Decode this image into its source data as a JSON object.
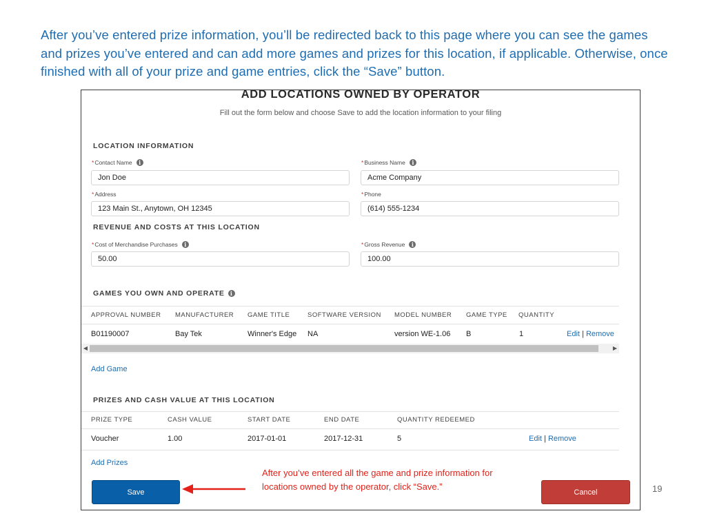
{
  "caption": "After you’ve entered prize information, you’ll be redirected back to this page where you can see the games and prizes you’ve entered and can add more games and prizes for this location, if applicable. Otherwise, once finished with all of your prize and game entries, click the “Save” button.",
  "form": {
    "title": "ADD LOCATIONS OWNED BY OPERATOR",
    "subtitle": "Fill out the form below and choose Save to add the location information to your filing",
    "location_section": "LOCATION INFORMATION",
    "fields": {
      "contact_name": {
        "label": "Contact Name",
        "value": "Jon Doe"
      },
      "business_name": {
        "label": "Business Name",
        "value": "Acme Company"
      },
      "address": {
        "label": "Address",
        "value": "123 Main St., Anytown, OH 12345"
      },
      "phone": {
        "label": "Phone",
        "value": "(614) 555-1234"
      },
      "cost_merch": {
        "label": "Cost of Merchandise Purchases",
        "value": "50.00"
      },
      "gross_revenue": {
        "label": "Gross Revenue",
        "value": "100.00"
      }
    },
    "required_mark": "*",
    "info_glyph": "i",
    "revenue_section": "REVENUE AND COSTS AT THIS LOCATION",
    "games_section": "GAMES YOU OWN AND OPERATE",
    "games_table": {
      "headers": [
        "APPROVAL NUMBER",
        "MANUFACTURER",
        "GAME TITLE",
        "SOFTWARE VERSION",
        "MODEL NUMBER",
        "GAME TYPE",
        "QUANTITY"
      ],
      "rows": [
        {
          "cells": [
            "B01190007",
            "Bay Tek",
            "Winner's Edge",
            "NA",
            "version WE-1.06",
            "B",
            "1"
          ],
          "edit": "Edit",
          "sep": "|",
          "remove": "Remove"
        }
      ]
    },
    "add_game": "Add Game",
    "prizes_section": "PRIZES AND CASH VALUE AT THIS LOCATION",
    "prizes_table": {
      "headers": [
        "PRIZE TYPE",
        "CASH VALUE",
        "START DATE",
        "END DATE",
        "QUANTITY REDEEMED"
      ],
      "rows": [
        {
          "cells": [
            "Voucher",
            "1.00",
            "2017-01-01",
            "2017-12-31",
            "5"
          ],
          "edit": "Edit",
          "sep": "|",
          "remove": "Remove"
        }
      ]
    },
    "add_prizes": "Add Prizes",
    "save_label": "Save",
    "cancel_label": "Cancel",
    "scroll_left": "◀",
    "scroll_right": "▶"
  },
  "annotation": "After you’ve entered all the game and prize information for locations owned by the operator, click “Save.”",
  "page_number": "19",
  "colors": {
    "accent": "#1f6db0",
    "save": "#0a60a8",
    "cancel": "#c03e37",
    "annotation": "#e32119"
  }
}
